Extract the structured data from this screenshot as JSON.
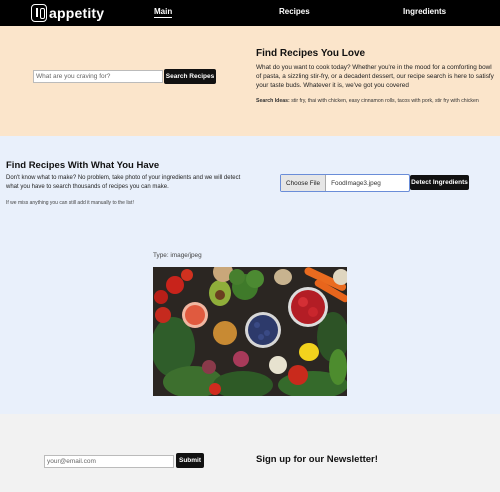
{
  "nav": {
    "brand": "appetity",
    "links": [
      "Main",
      "Recipes",
      "Ingredients"
    ]
  },
  "hero": {
    "search_placeholder": "What are you craving for?",
    "search_button": "Search Recipes",
    "title": "Find Recipes You Love",
    "text": "What do you want to cook today? Whether you're in the mood for a comforting bowl of pasta, a sizzling stir-fry, or a decadent dessert, our recipe search is here to satisfy your taste buds. Whatever it is, we've got you covered",
    "ideas_label": "Search Ideas:",
    "ideas": "stir fry, thai with chicken, easy cinnamon rolls, tacos with pork, stir fry with chicken"
  },
  "detect": {
    "title": "Find Recipes With What You Have",
    "text": "Don't know what to make? No problem, take photo of your ingredients and we will detect what you have to search thousands of recipes you can make.",
    "note": "If we miss anything you can still add it manually to the list!",
    "choose_file": "Choose File",
    "file_name": "FoodImage3.jpeg",
    "detect_button": "Detect Ingredients",
    "type_label": "Type: image/jpeg"
  },
  "newsletter": {
    "email_placeholder": "your@email.com",
    "submit_button": "Submit",
    "title": "Sign up for our Newsletter!"
  },
  "colors": {
    "nav_bg": "#000000",
    "hero_bg": "#fbe5cb",
    "detect_bg": "#e9f0fb",
    "newsletter_bg": "#f2f2f2",
    "button_bg": "#111111"
  }
}
